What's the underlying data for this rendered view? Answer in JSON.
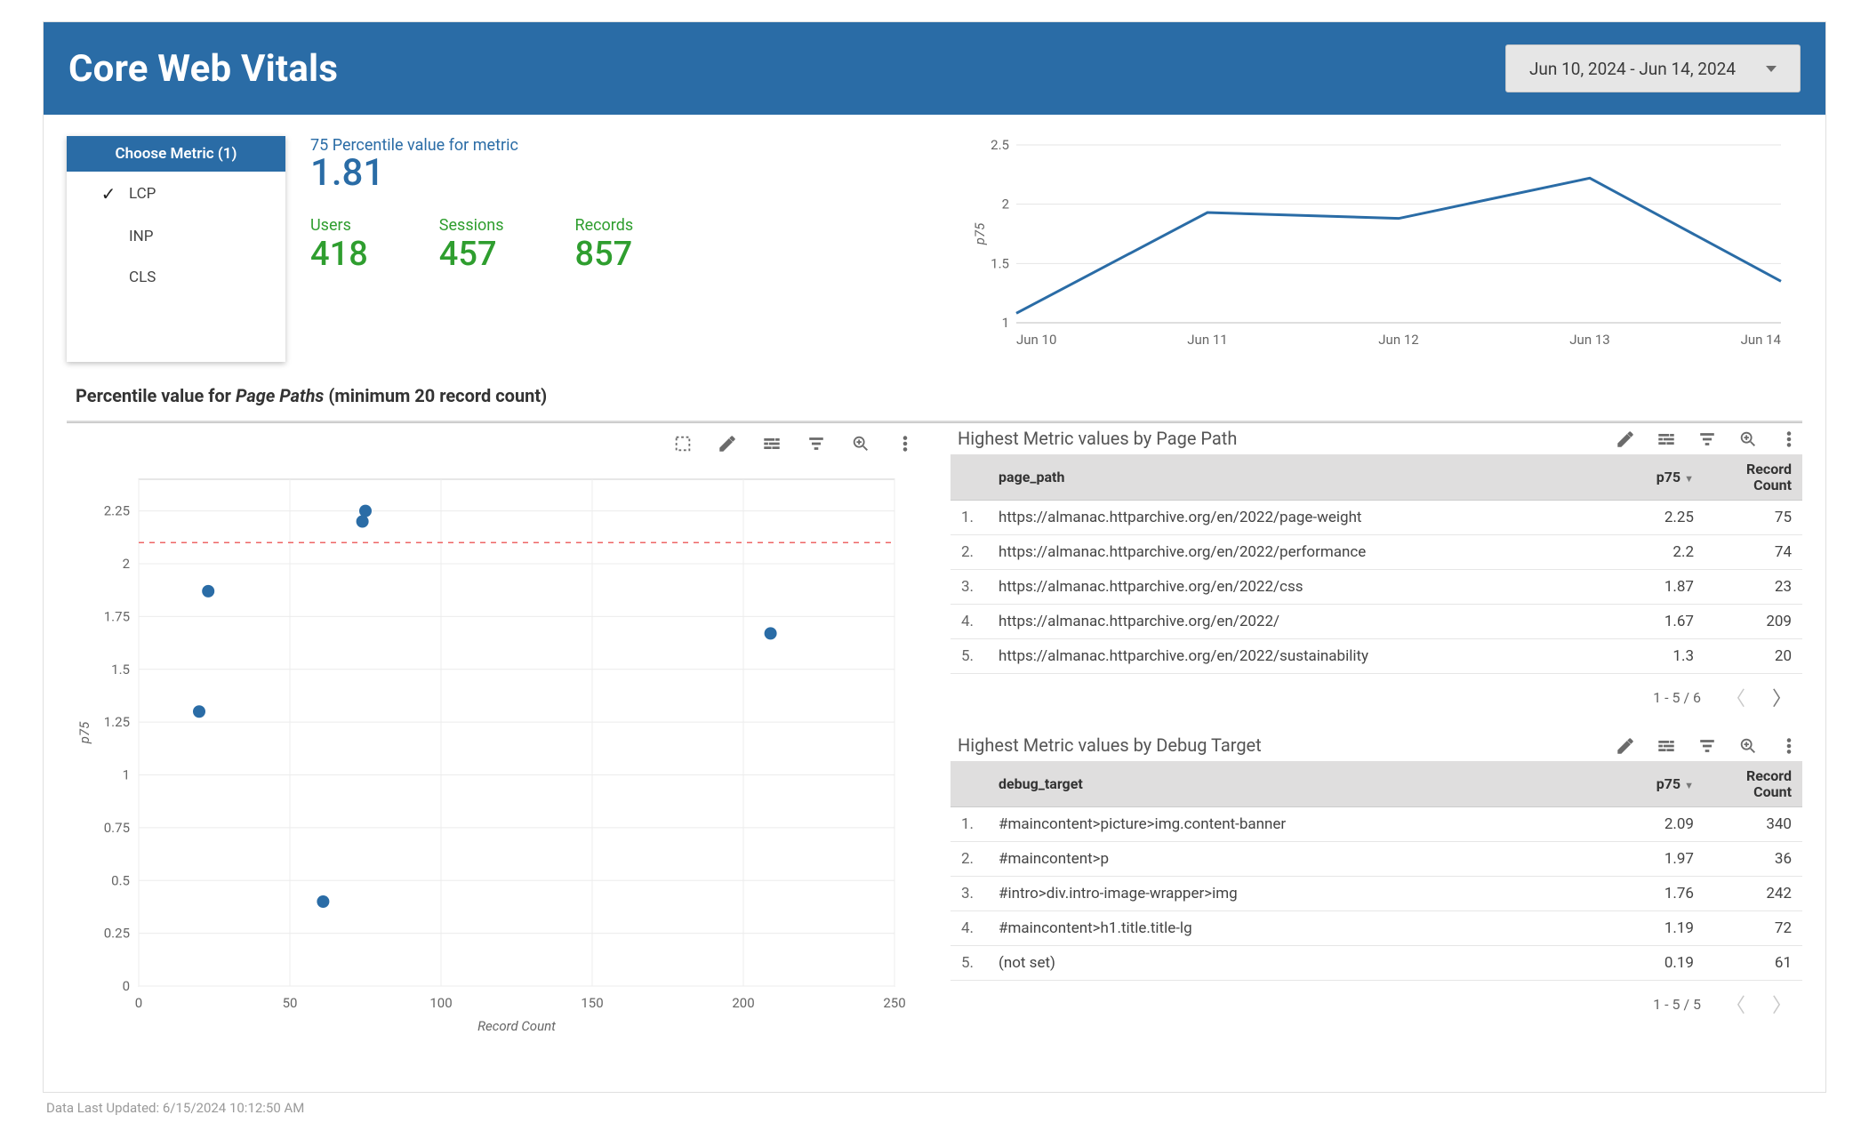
{
  "header": {
    "title": "Core Web Vitals",
    "date_range": "Jun 10, 2024 - Jun 14, 2024"
  },
  "metric_picker": {
    "header": "Choose Metric (1)",
    "options": [
      {
        "label": "LCP",
        "selected": true
      },
      {
        "label": "INP",
        "selected": false
      },
      {
        "label": "CLS",
        "selected": false
      }
    ]
  },
  "kpis": {
    "p75_label": "75 Percentile value for metric",
    "p75_value": "1.81",
    "users_label": "Users",
    "users_value": "418",
    "sessions_label": "Sessions",
    "sessions_value": "457",
    "records_label": "Records",
    "records_value": "857"
  },
  "section_title_prefix": "Percentile value for ",
  "section_title_em": "Page Paths",
  "section_title_suffix": " (minimum 20 record count)",
  "tables": {
    "page_path": {
      "title": "Highest Metric values by Page Path",
      "cols": {
        "dim": "page_path",
        "p75": "p75",
        "count": "Record Count"
      },
      "rows": [
        {
          "idx": "1.",
          "dim": "https://almanac.httparchive.org/en/2022/page-weight",
          "p75": "2.25",
          "count": "75"
        },
        {
          "idx": "2.",
          "dim": "https://almanac.httparchive.org/en/2022/performance",
          "p75": "2.2",
          "count": "74"
        },
        {
          "idx": "3.",
          "dim": "https://almanac.httparchive.org/en/2022/css",
          "p75": "1.87",
          "count": "23"
        },
        {
          "idx": "4.",
          "dim": "https://almanac.httparchive.org/en/2022/",
          "p75": "1.67",
          "count": "209"
        },
        {
          "idx": "5.",
          "dim": "https://almanac.httparchive.org/en/2022/sustainability",
          "p75": "1.3",
          "count": "20"
        }
      ],
      "pager": "1 - 5 / 6"
    },
    "debug_target": {
      "title": "Highest Metric values by Debug Target",
      "cols": {
        "dim": "debug_target",
        "p75": "p75",
        "count": "Record Count"
      },
      "rows": [
        {
          "idx": "1.",
          "dim": "#maincontent>picture>img.content-banner",
          "p75": "2.09",
          "count": "340"
        },
        {
          "idx": "2.",
          "dim": "#maincontent>p",
          "p75": "1.97",
          "count": "36"
        },
        {
          "idx": "3.",
          "dim": "#intro>div.intro-image-wrapper>img",
          "p75": "1.76",
          "count": "242"
        },
        {
          "idx": "4.",
          "dim": "#maincontent>h1.title.title-lg",
          "p75": "1.19",
          "count": "72"
        },
        {
          "idx": "5.",
          "dim": "(not set)",
          "p75": "0.19",
          "count": "61"
        }
      ],
      "pager": "1 - 5 / 5"
    }
  },
  "footer": "Data Last Updated: 6/15/2024 10:12:50 AM",
  "chart_data": [
    {
      "type": "line",
      "title": "",
      "ylabel": "p75",
      "xlabel": "",
      "categories": [
        "Jun 10",
        "Jun 11",
        "Jun 12",
        "Jun 13",
        "Jun 14"
      ],
      "values": [
        1.08,
        1.93,
        1.88,
        2.22,
        1.35
      ],
      "ylim": [
        1,
        2.5
      ],
      "y_ticks": [
        1,
        1.5,
        2,
        2.5
      ]
    },
    {
      "type": "scatter",
      "title": "",
      "xlabel": "Record Count",
      "ylabel": "p75",
      "xlim": [
        0,
        250
      ],
      "ylim": [
        0,
        2.4
      ],
      "x_ticks": [
        0,
        50,
        100,
        150,
        200,
        250
      ],
      "y_ticks": [
        0,
        0.25,
        0.5,
        0.75,
        1,
        1.25,
        1.5,
        1.75,
        2,
        2.25
      ],
      "threshold": 2.1,
      "points": [
        {
          "x": 75,
          "y": 2.25
        },
        {
          "x": 74,
          "y": 2.2
        },
        {
          "x": 23,
          "y": 1.87
        },
        {
          "x": 209,
          "y": 1.67
        },
        {
          "x": 20,
          "y": 1.3
        },
        {
          "x": 61,
          "y": 0.4
        }
      ]
    }
  ]
}
